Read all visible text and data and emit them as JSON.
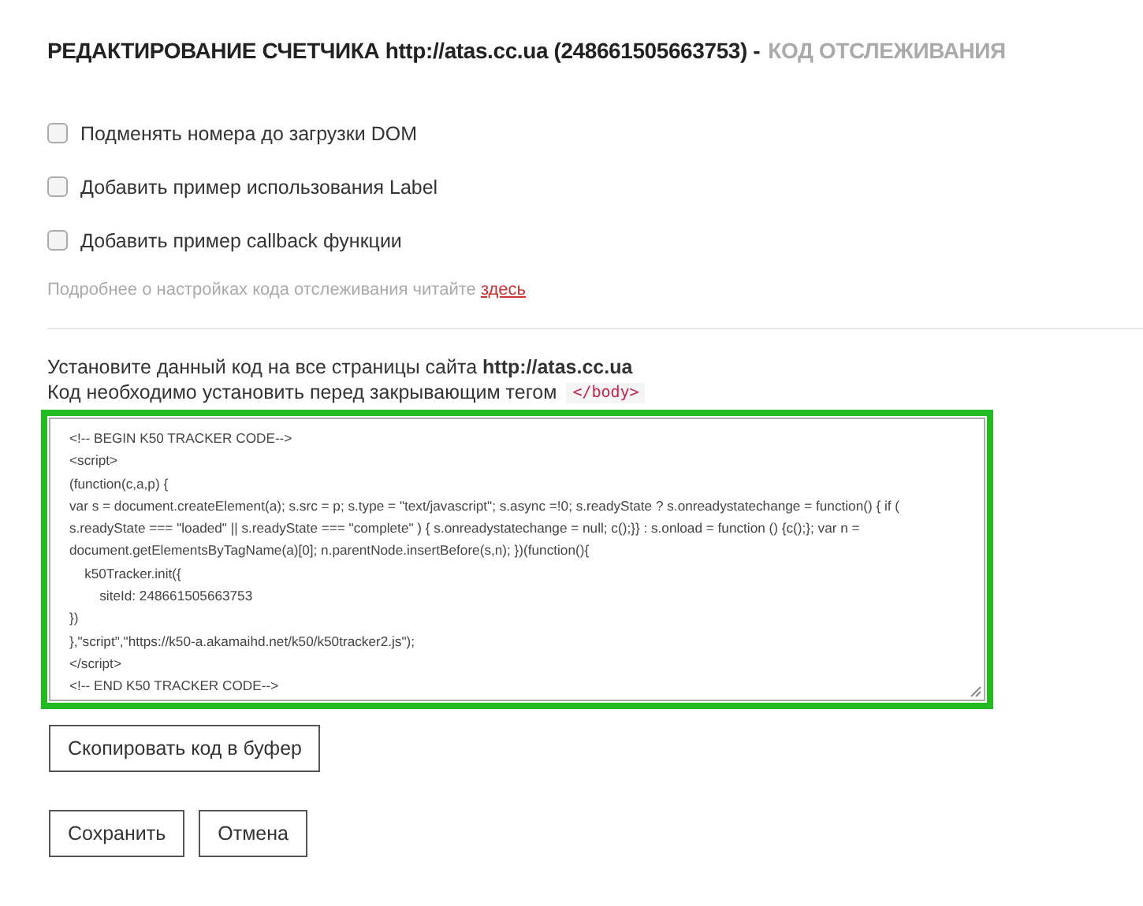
{
  "title": {
    "main": "РЕДАКТИРОВАНИЕ СЧЕТЧИКА http://atas.cc.ua (248661505663753) -",
    "sub": "КОД ОТСЛЕЖИВАНИЯ"
  },
  "options": [
    {
      "label": "Подменять номера до загрузки DOM",
      "checked": false
    },
    {
      "label": "Добавить пример использования Label",
      "checked": false
    },
    {
      "label": "Добавить пример callback функции",
      "checked": false
    }
  ],
  "help": {
    "text": "Подробнее о настройках кода отслеживания читайте",
    "link": "здесь"
  },
  "install": {
    "line1": "Установите данный код на все страницы сайта **http://atas.cc.ua**",
    "line2": "Код необходимо установить перед закрывающим тегом",
    "tag": "</body>"
  },
  "code": [
    "<!-- BEGIN K50 TRACKER CODE-->",
    "<script>",
    "(function(c,a,p) {",
    "var s = document.createElement(a); s.src = p; s.type = \"text/javascript\"; s.async =!0; s.readyState ? s.onreadystatechange = function() { if ( s.readyState === \"loaded\" || s.readyState === \"complete\" ) { s.onreadystatechange = null; c();}} : s.onload = function () {c();}; var n = document.getElementsByTagName(a)[0]; n.parentNode.insertBefore(s,n); })(function(){",
    "    k50Tracker.init({",
    "        siteId: 248661505663753",
    "})",
    "},\"script\",\"https://k50-a.akamaihd.net/k50/k50tracker2.js\");",
    "</script>",
    "<!-- END K50 TRACKER CODE-->"
  ],
  "copy_button": "Скопировать код в буфер",
  "buttons": [
    "Сохранить",
    "Отмена"
  ]
}
